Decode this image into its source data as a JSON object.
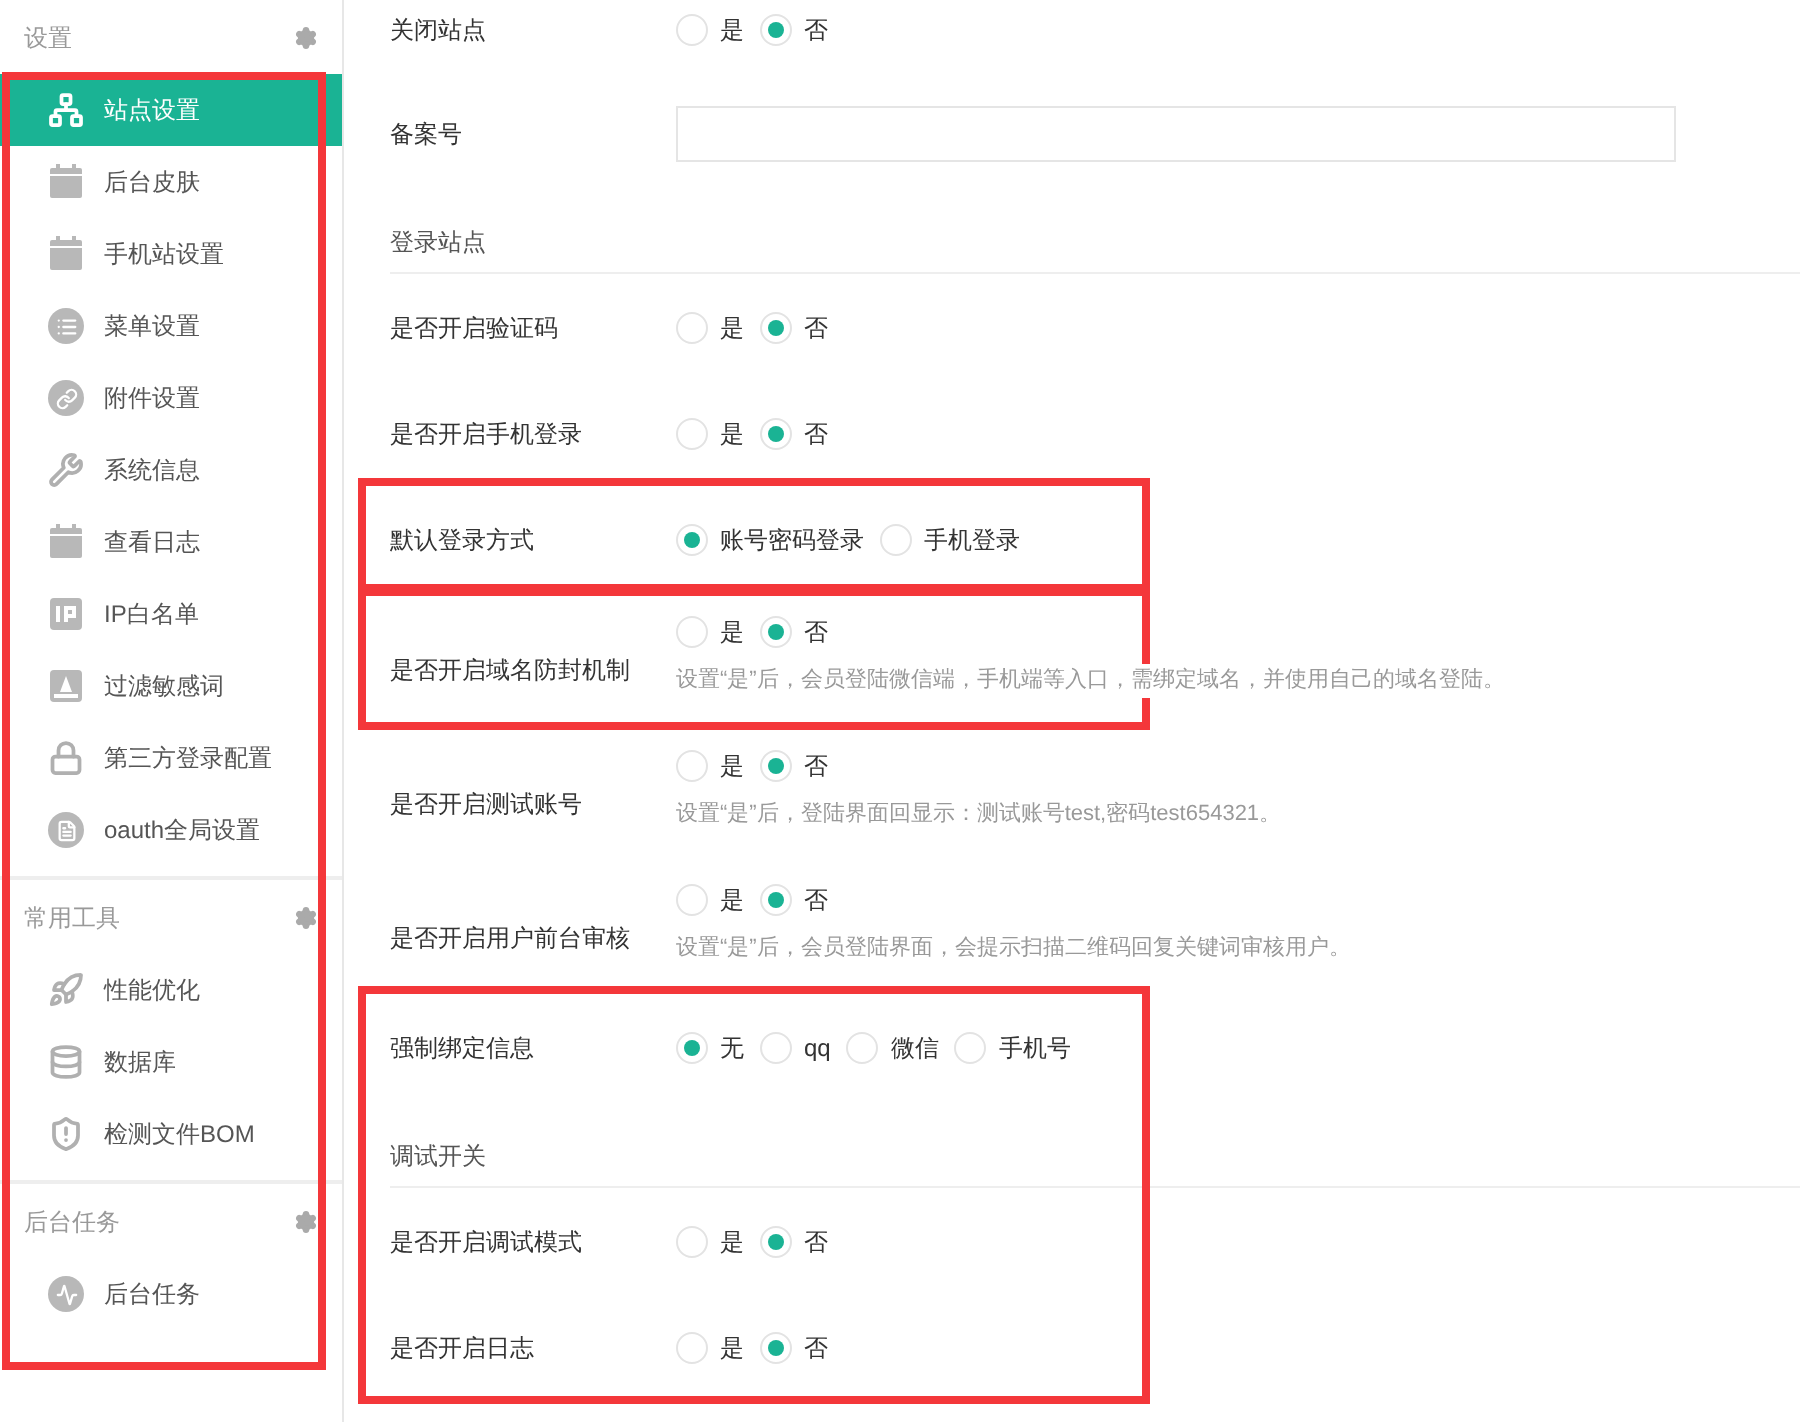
{
  "sidebar": {
    "highlighted": true,
    "groups": [
      {
        "title": "设置",
        "items": [
          {
            "label": "站点设置",
            "selected": true
          },
          {
            "label": "后台皮肤",
            "selected": false
          },
          {
            "label": "手机站设置",
            "selected": false
          },
          {
            "label": "菜单设置",
            "selected": false
          },
          {
            "label": "附件设置",
            "selected": false
          },
          {
            "label": "系统信息",
            "selected": false
          },
          {
            "label": "查看日志",
            "selected": false
          },
          {
            "label": "IP白名单",
            "selected": false
          },
          {
            "label": "过滤敏感词",
            "selected": false
          },
          {
            "label": "第三方登录配置",
            "selected": false
          },
          {
            "label": "oauth全局设置",
            "selected": false
          }
        ]
      },
      {
        "title": "常用工具",
        "items": [
          {
            "label": "性能优化",
            "selected": false
          },
          {
            "label": "数据库",
            "selected": false
          },
          {
            "label": "检测文件BOM",
            "selected": false
          }
        ]
      },
      {
        "title": "后台任务",
        "items": [
          {
            "label": "后台任务",
            "selected": false
          }
        ]
      }
    ]
  },
  "form": {
    "blocks": [
      {
        "highlighted": false,
        "fields": [
          {
            "kind": "radio",
            "label": "关闭站点",
            "options": [
              {
                "label": "是",
                "selected": false
              },
              {
                "label": "否",
                "selected": true
              }
            ]
          },
          {
            "kind": "text",
            "label": "备案号"
          },
          {
            "kind": "section",
            "label": "登录站点"
          },
          {
            "kind": "radio",
            "label": "是否开启验证码",
            "options": [
              {
                "label": "是",
                "selected": false
              },
              {
                "label": "否",
                "selected": true
              }
            ]
          },
          {
            "kind": "radio",
            "label": "是否开启手机登录",
            "options": [
              {
                "label": "是",
                "selected": false
              },
              {
                "label": "否",
                "selected": true
              }
            ]
          }
        ]
      },
      {
        "highlighted": true,
        "fields": [
          {
            "kind": "radio",
            "label": "默认登录方式",
            "options": [
              {
                "label": "账号密码登录",
                "selected": true
              },
              {
                "label": "手机登录",
                "selected": false
              }
            ]
          }
        ]
      },
      {
        "highlighted": true,
        "fields": [
          {
            "kind": "radio",
            "label": "是否开启域名防封机制",
            "options": [
              {
                "label": "是",
                "selected": false
              },
              {
                "label": "否",
                "selected": true
              }
            ],
            "hint": "设置“是”后，会员登陆微信端，手机端等入口，需绑定域名，并使用自己的域名登陆。"
          }
        ]
      },
      {
        "highlighted": false,
        "fields": [
          {
            "kind": "radio",
            "label": "是否开启测试账号",
            "options": [
              {
                "label": "是",
                "selected": false
              },
              {
                "label": "否",
                "selected": true
              }
            ],
            "hint": "设置“是”后，登陆界面回显示：测试账号test,密码test654321。"
          },
          {
            "kind": "radio",
            "label": "是否开启用户前台审核",
            "options": [
              {
                "label": "是",
                "selected": false
              },
              {
                "label": "否",
                "selected": true
              }
            ],
            "hint": "设置“是”后，会员登陆界面，会提示扫描二维码回复关键词审核用户。"
          }
        ]
      },
      {
        "highlighted": true,
        "fields": [
          {
            "kind": "radio",
            "label": "强制绑定信息",
            "options": [
              {
                "label": "无",
                "selected": true
              },
              {
                "label": "qq",
                "selected": false
              },
              {
                "label": "微信",
                "selected": false
              },
              {
                "label": "手机号",
                "selected": false
              }
            ]
          },
          {
            "kind": "section",
            "label": "调试开关"
          },
          {
            "kind": "radio",
            "label": "是否开启调试模式",
            "options": [
              {
                "label": "是",
                "selected": false
              },
              {
                "label": "否",
                "selected": true
              }
            ]
          },
          {
            "kind": "radio",
            "label": "是否开启日志",
            "options": [
              {
                "label": "是",
                "selected": false
              },
              {
                "label": "否",
                "selected": true
              }
            ]
          }
        ]
      }
    ]
  }
}
